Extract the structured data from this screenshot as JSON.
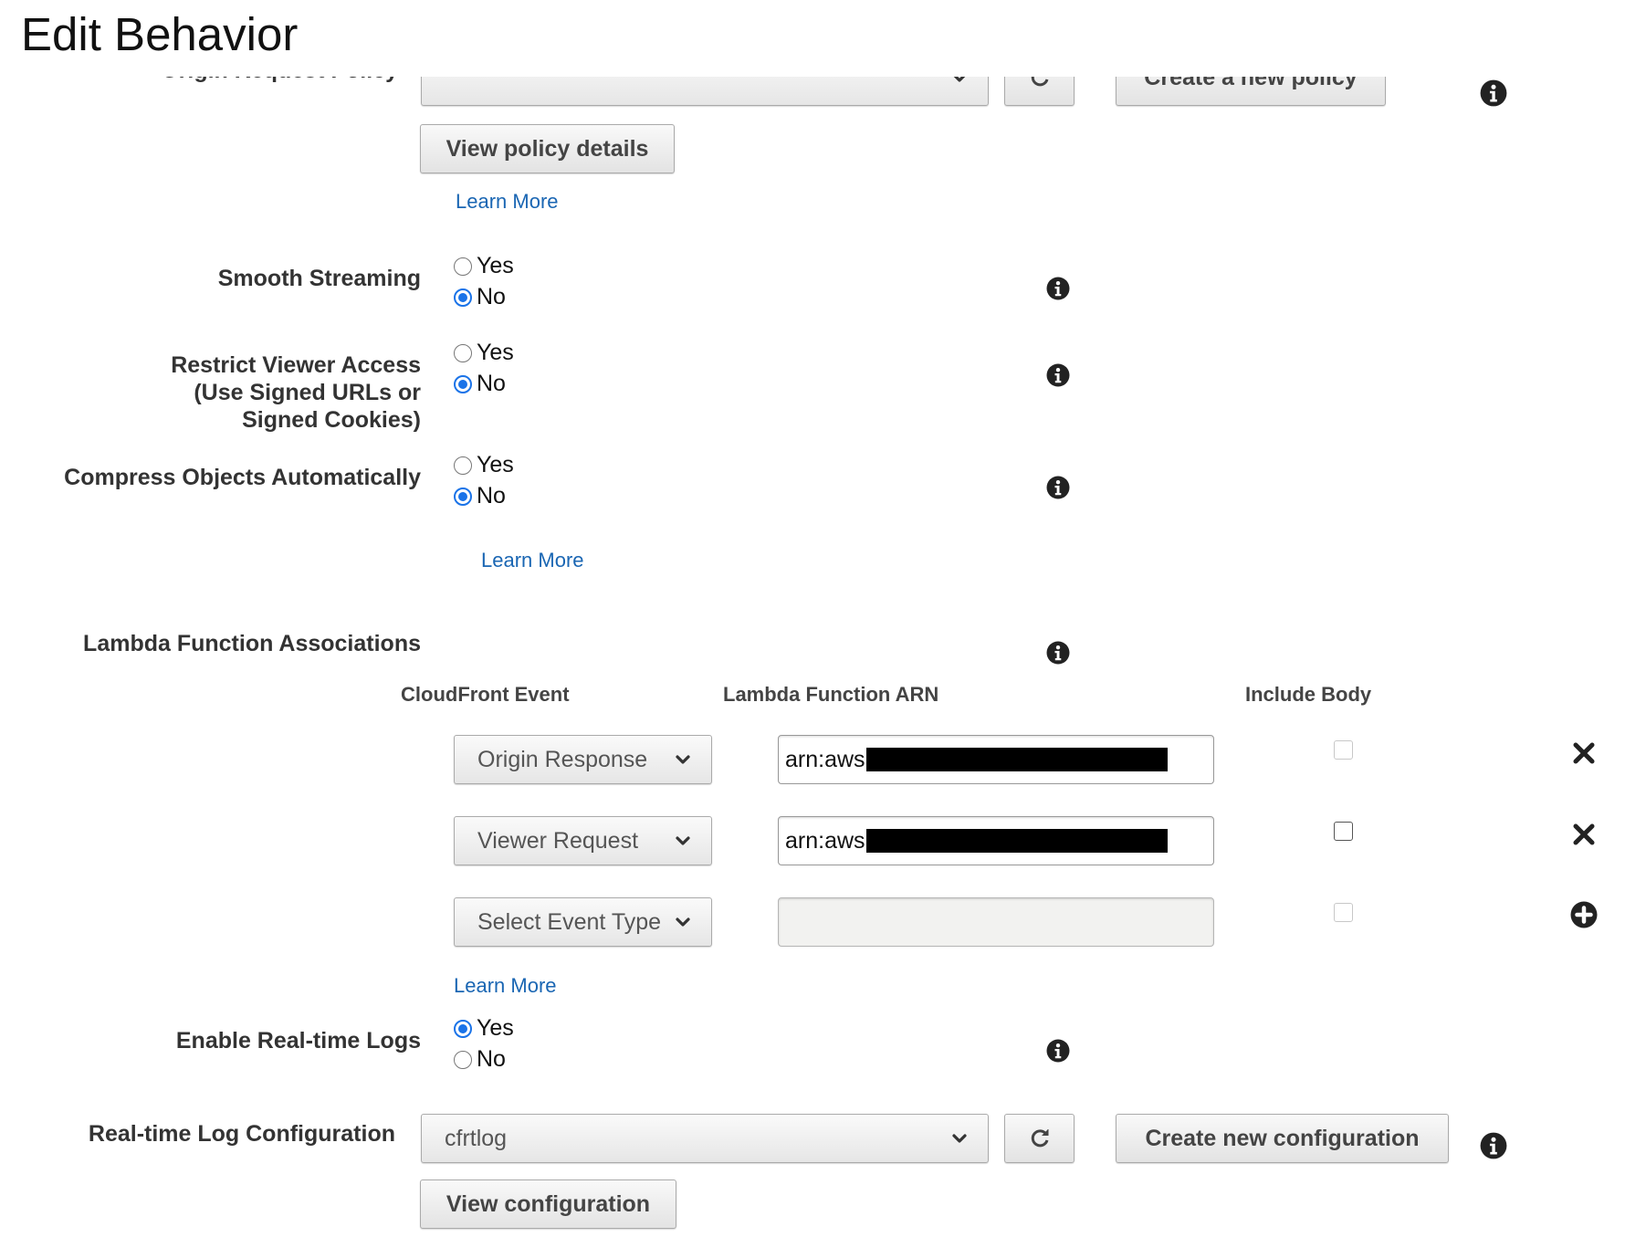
{
  "page_title": "Edit Behavior",
  "origin_request_policy": {
    "label": "Origin Request Policy",
    "selected": "",
    "create_button": "Create a new policy",
    "view_button": "View policy details",
    "learn_more": "Learn More"
  },
  "smooth_streaming": {
    "label": "Smooth Streaming",
    "yes": "Yes",
    "no": "No",
    "selected": "No"
  },
  "restrict_viewer_access": {
    "label_line1": "Restrict Viewer Access",
    "label_line2": "(Use Signed URLs or",
    "label_line3": "Signed Cookies)",
    "yes": "Yes",
    "no": "No",
    "selected": "No"
  },
  "compress_objects": {
    "label": "Compress Objects Automatically",
    "yes": "Yes",
    "no": "No",
    "selected": "No",
    "learn_more": "Learn More"
  },
  "lambda": {
    "label": "Lambda Function Associations",
    "col_event": "CloudFront Event",
    "col_arn": "Lambda Function ARN",
    "col_body": "Include Body",
    "rows": [
      {
        "event": "Origin Response",
        "arn": "arn:aws",
        "include_body": false,
        "body_enabled": false,
        "action": "remove"
      },
      {
        "event": "Viewer Request",
        "arn": "arn:aws",
        "include_body": false,
        "body_enabled": true,
        "action": "remove"
      },
      {
        "event": "Select Event Type",
        "arn": "",
        "include_body": false,
        "body_enabled": false,
        "action": "add"
      }
    ],
    "learn_more": "Learn More"
  },
  "realtime_logs": {
    "label": "Enable Real-time Logs",
    "yes": "Yes",
    "no": "No",
    "selected": "Yes"
  },
  "realtime_log_config": {
    "label": "Real-time Log Configuration",
    "selected": "cfrtlog",
    "create_button": "Create new configuration",
    "view_button": "View configuration"
  },
  "colors": {
    "link": "#1a66b3",
    "radio_selected": "#1a73e8"
  }
}
